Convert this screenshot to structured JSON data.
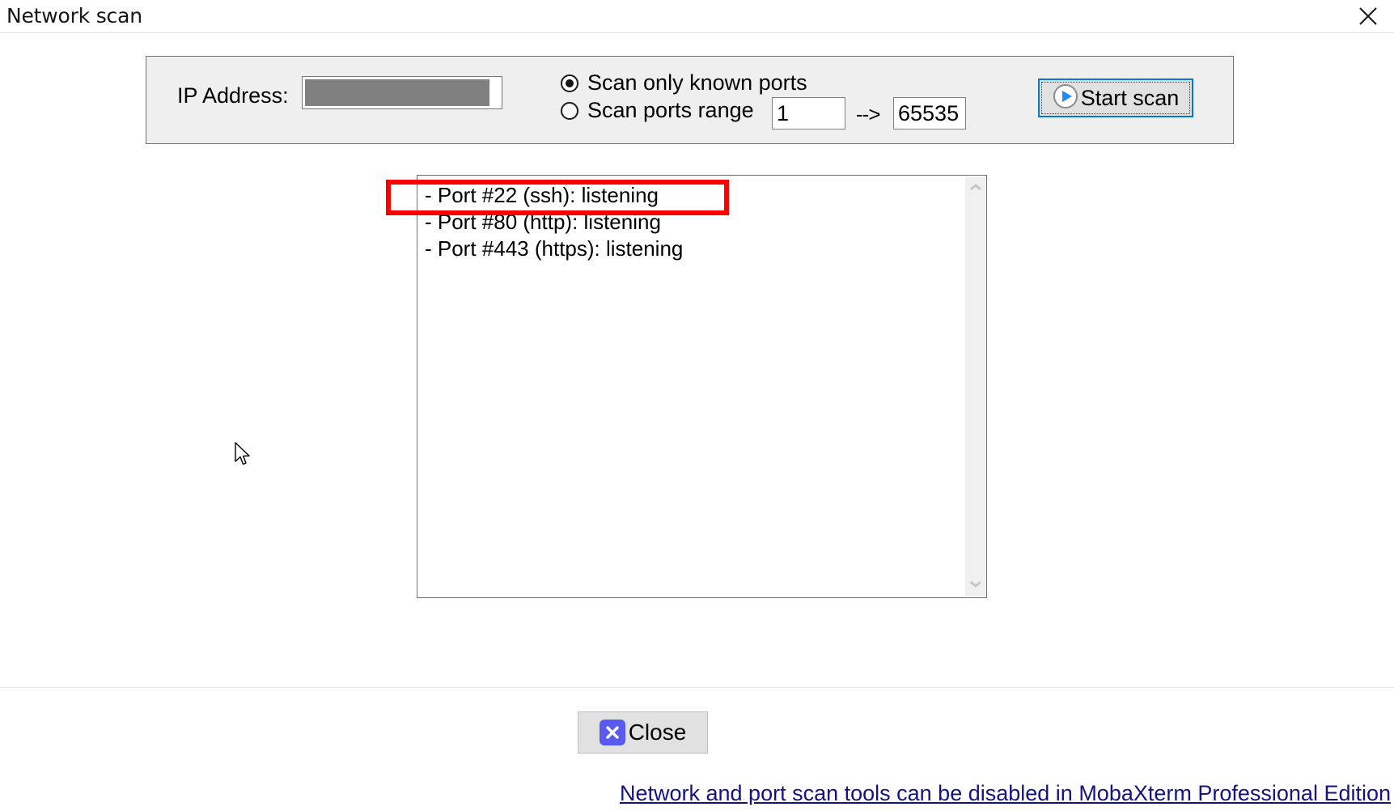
{
  "window": {
    "title": "Network scan",
    "close_icon": "close-icon"
  },
  "options": {
    "ip_label": "IP Address:",
    "ip_value": "",
    "ip_redacted": true,
    "radios": [
      {
        "label": "Scan only known ports",
        "checked": true
      },
      {
        "label": "Scan ports range",
        "checked": false
      }
    ],
    "port_from": "1",
    "port_to": "65535",
    "range_arrow": "-->",
    "start_scan": {
      "label": "Start scan",
      "icon": "play-circle-icon",
      "icon_color": "#1a8cff",
      "focus_border_color": "#0078d7"
    }
  },
  "results": {
    "lines": [
      "- Port #22 (ssh):  listening",
      "- Port #80 (http):  listening",
      "- Port #443 (https):  listening"
    ],
    "scrollbar": {
      "up_icon": "chevron-up-icon",
      "down_icon": "chevron-down-icon"
    }
  },
  "annotation": {
    "color": "#fb0000",
    "targets_line": "- Port #22 (ssh):  listening"
  },
  "footer": {
    "close_label": "Close",
    "close_icon": "x-square-icon",
    "close_icon_color": "#5a5af0",
    "promo_text": "Network and port scan tools can be disabled in MobaXterm Professional Edition",
    "promo_color": "#131383"
  }
}
